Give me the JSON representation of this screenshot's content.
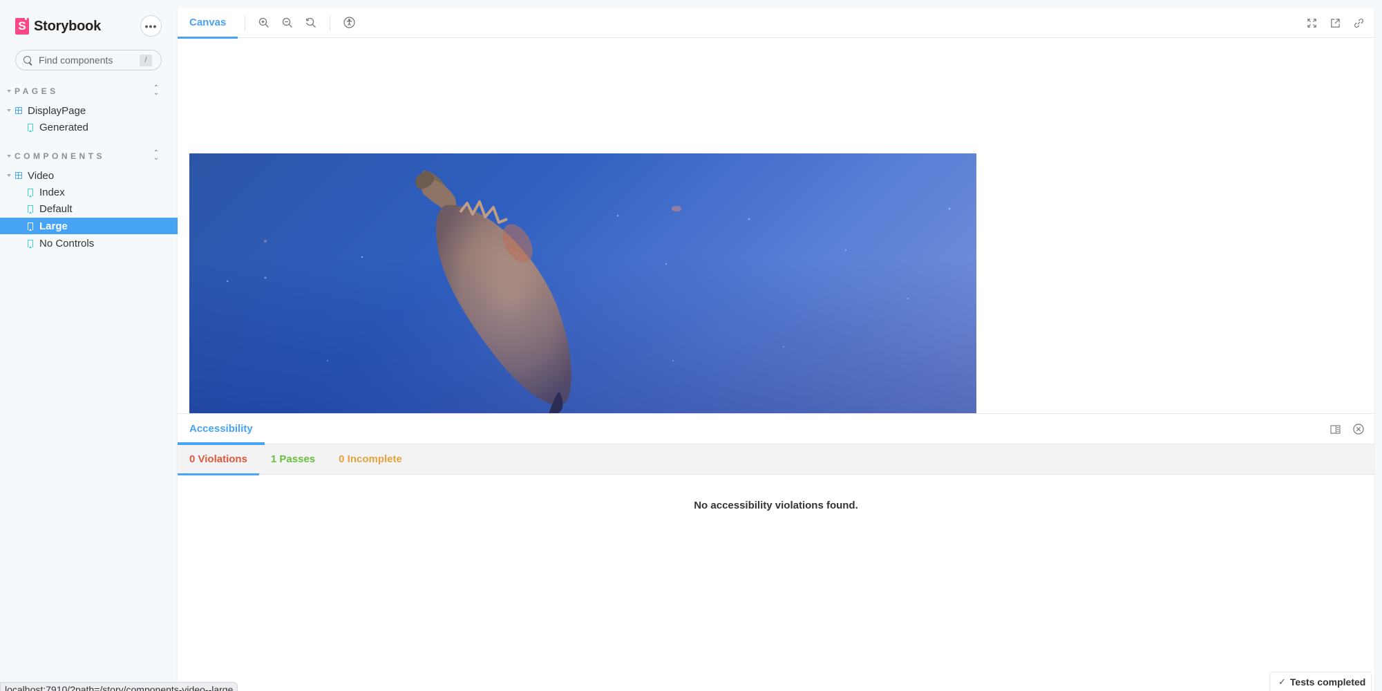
{
  "app": {
    "brand": "Storybook",
    "brand_logo_letter": "S",
    "menu_label": "•••"
  },
  "search": {
    "placeholder": "Find components",
    "value": "",
    "shortcut": "/"
  },
  "sidebar": {
    "sections": [
      {
        "title": "PAGES",
        "groups": [
          {
            "label": "DisplayPage",
            "stories": [
              {
                "label": "Generated",
                "selected": false
              }
            ]
          }
        ]
      },
      {
        "title": "COMPONENTS",
        "groups": [
          {
            "label": "Video",
            "stories": [
              {
                "label": "Index",
                "selected": false
              },
              {
                "label": "Default",
                "selected": false
              },
              {
                "label": "Large",
                "selected": true
              },
              {
                "label": "No Controls",
                "selected": false
              }
            ]
          }
        ]
      }
    ]
  },
  "toolbar": {
    "tabs": [
      {
        "label": "Canvas",
        "active": true
      }
    ],
    "tools": [
      "zoom-in",
      "zoom-out",
      "zoom-reset",
      "accessibility"
    ],
    "right_tools": [
      "fullscreen",
      "open-new-tab",
      "copy-link"
    ]
  },
  "canvas": {
    "media": "Underwater video frame of a sea turtle swimming in blue water"
  },
  "addons": {
    "tabs": [
      {
        "label": "Accessibility",
        "active": true
      }
    ],
    "subtabs": [
      {
        "label": "0 Violations",
        "color": "#e0573a",
        "active": true
      },
      {
        "label": "1 Passes",
        "color": "#66bf3c",
        "active": false
      },
      {
        "label": "0 Incomplete",
        "color": "#e6a23c",
        "active": false
      }
    ],
    "message": "No accessibility violations found."
  },
  "status": {
    "url": "localhost:7910/?path=/story/components-video--large",
    "tests": "Tests completed"
  },
  "colors": {
    "accent": "#47a3f3",
    "brand": "#ff4785",
    "story_icon": "#37d5d3"
  }
}
